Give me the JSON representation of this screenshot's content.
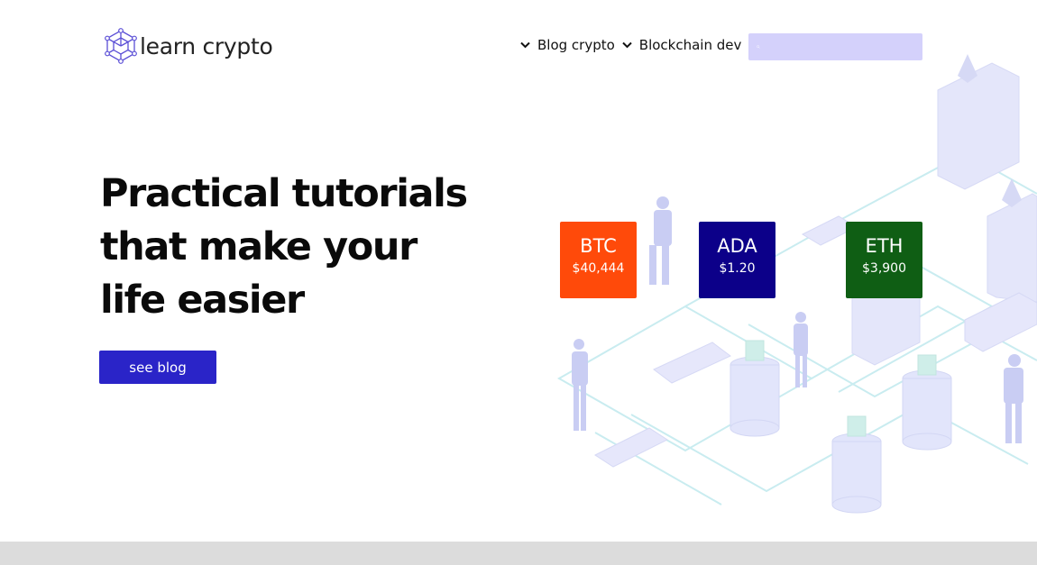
{
  "header": {
    "logo_text": "learn crypto",
    "nav": [
      {
        "label": "Blog crypto",
        "icon": "chevron-down-icon"
      },
      {
        "label": "Blockchain dev",
        "icon": "chevron-down-icon"
      }
    ],
    "search": {
      "value": "",
      "placeholder": "",
      "icon": "search-icon"
    }
  },
  "hero": {
    "title_lines": [
      "Practical tutorials",
      "that make your",
      "life easier"
    ],
    "cta_label": "see blog"
  },
  "coins": [
    {
      "symbol": "BTC",
      "price": "$40,444",
      "color": "#ff4a0a"
    },
    {
      "symbol": "ADA",
      "price": "$1.20",
      "color": "#0c0089"
    },
    {
      "symbol": "ETH",
      "price": "$3,900",
      "color": "#0f5e14"
    }
  ],
  "colors": {
    "accent": "#2a24c8",
    "search_bg": "#d4d1fb",
    "illustration_tint": "#c9cdf3",
    "footer_band": "#dcdcdc"
  }
}
